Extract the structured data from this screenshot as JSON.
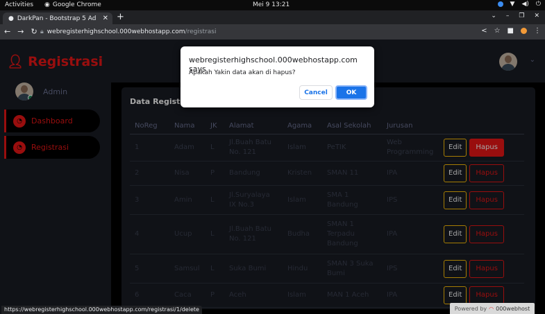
{
  "os": {
    "activities": "Activities",
    "app_name": "Google Chrome",
    "clock": "Mei 9  13:21"
  },
  "browser": {
    "tab_title": "DarkPan - Bootstrap 5 Ad",
    "url_host": "webregisterhighschool.000webhostapp.com",
    "url_path": "/registrasi",
    "status_url": "https://webregisterhighschool.000webhostapp.com/registrasi/1/delete"
  },
  "sidebar": {
    "brand": "Registrasi",
    "user_name": "Admin",
    "items": [
      {
        "label": "Dashboard"
      },
      {
        "label": "Registrasi"
      }
    ]
  },
  "card": {
    "title": "Data Registrasi"
  },
  "table": {
    "headers": [
      "NoReg",
      "Nama",
      "JK",
      "Alamat",
      "Agama",
      "Asal Sekolah",
      "Jurusan"
    ],
    "edit_label": "Edit",
    "hapus_label": "Hapus",
    "rows": [
      {
        "noreg": "1",
        "nama": "Adam",
        "jk": "L",
        "alamat": "Jl.Buah Batu No. 121",
        "agama": "Islam",
        "sekolah": "PeTIK",
        "jurusan": "Web Programming"
      },
      {
        "noreg": "2",
        "nama": "Nisa",
        "jk": "P",
        "alamat": "Bandung",
        "agama": "Kristen",
        "sekolah": "SMAN 11",
        "jurusan": "IPA"
      },
      {
        "noreg": "3",
        "nama": "Amin",
        "jk": "L",
        "alamat": "Jl.Suryalaya IX No.3",
        "agama": "Islam",
        "sekolah": "SMA 1 Bandung",
        "jurusan": "IPS"
      },
      {
        "noreg": "4",
        "nama": "Ucup",
        "jk": "L",
        "alamat": "Jl.Buah Batu No. 121",
        "agama": "Budha",
        "sekolah": "SMAN 1 Terpadu Bandung",
        "jurusan": "IPA"
      },
      {
        "noreg": "5",
        "nama": "Samsul",
        "jk": "L",
        "alamat": "Suka Bumi",
        "agama": "Hindu",
        "sekolah": "SMAN 3 Suka Bumi",
        "jurusan": "IPS"
      },
      {
        "noreg": "6",
        "nama": "Caca",
        "jk": "P",
        "alamat": "Aceh",
        "agama": "Islam",
        "sekolah": "MAN 1 Aceh",
        "jurusan": "IPA"
      }
    ]
  },
  "dialog": {
    "title": "webregisterhighschool.000webhostapp.com says",
    "message": "Apakah Yakin data akan di hapus?",
    "cancel_label": "Cancel",
    "ok_label": "OK"
  },
  "footer": {
    "powered_by": "Powered by",
    "host_brand": "000webhost"
  },
  "colors": {
    "accent": "#eb1616",
    "panel": "#191c24",
    "warning": "#ffc107",
    "dialog_primary": "#1a73e8"
  }
}
